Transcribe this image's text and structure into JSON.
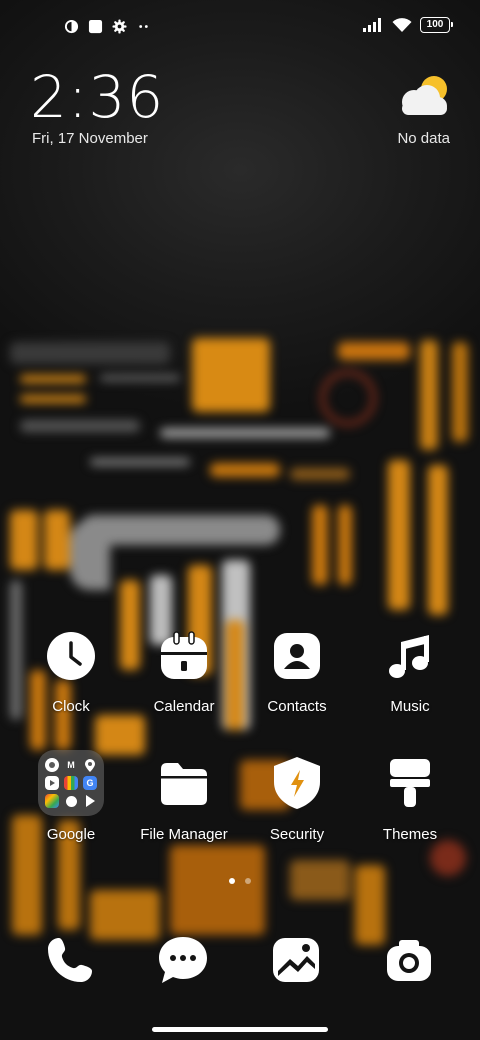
{
  "status_bar": {
    "icons_left": [
      "notification-app-icon",
      "notification-square-icon",
      "settings-gear-icon",
      "more-dots-icon"
    ],
    "icons_right": [
      "signal-icon",
      "wifi-icon",
      "battery-icon"
    ],
    "battery_level": "100"
  },
  "clock_widget": {
    "time": "2:36",
    "date": "Fri, 17 November"
  },
  "weather_widget": {
    "icon": "partly-cloudy-icon",
    "status": "No data"
  },
  "apps_row1": [
    {
      "label": "Clock",
      "icon": "clock-icon"
    },
    {
      "label": "Calendar",
      "icon": "calendar-icon"
    },
    {
      "label": "Contacts",
      "icon": "contacts-icon"
    },
    {
      "label": "Music",
      "icon": "music-icon"
    }
  ],
  "apps_row2": [
    {
      "label": "Google",
      "icon": "folder-icon"
    },
    {
      "label": "File Manager",
      "icon": "file-manager-icon"
    },
    {
      "label": "Security",
      "icon": "security-icon"
    },
    {
      "label": "Themes",
      "icon": "themes-icon"
    }
  ],
  "google_folder": {
    "items": [
      "chrome-icon",
      "gmail-icon",
      "maps-icon",
      "youtube-icon",
      "google-icon",
      "translate-icon",
      "photos-icon",
      "assistant-icon",
      "play-store-icon"
    ]
  },
  "pages": {
    "count": 2,
    "active": 1
  },
  "dock": [
    {
      "name": "phone",
      "icon": "phone-icon"
    },
    {
      "name": "messages",
      "icon": "messages-icon"
    },
    {
      "name": "gallery",
      "icon": "gallery-icon"
    },
    {
      "name": "camera",
      "icon": "camera-icon"
    }
  ],
  "colors": {
    "accent_orange": "#e0900f",
    "icon_white": "#ffffff",
    "background": "#141414"
  }
}
